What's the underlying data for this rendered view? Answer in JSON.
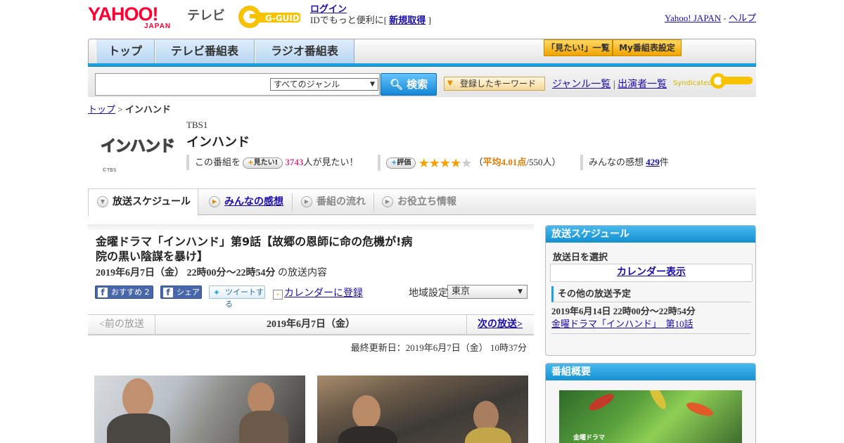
{
  "header": {
    "yahoo_logo": "YAHOO!",
    "yahoo_logo_sub": "JAPAN",
    "tv_label": "テレビ",
    "gguide_logo": "G-GUIDE",
    "login": "ログイン",
    "id_note_prefix": "IDでもっと便利に[",
    "signup": "新規取得",
    "id_note_suffix": "]",
    "yahoo_japan_link": "Yahoo! JAPAN",
    "separator": "-",
    "help_link": "ヘルプ"
  },
  "nav": {
    "top": "トップ",
    "tv_schedule": "テレビ番組表",
    "radio_schedule": "ラジオ番組表",
    "watchlist": "「見たい!」一覧",
    "my_schedule": "My番組表設定"
  },
  "search": {
    "placeholder": "",
    "genre_selected": "すべてのジャンル",
    "button": "検索",
    "keyword_button": "登録したキーワード",
    "genre_list": "ジャンル一覧",
    "pipe": "|",
    "performer_list": "出演者一覧",
    "syndicated": "Syndicated"
  },
  "breadcrumb": {
    "top": "トップ",
    "sep": ">",
    "current": "インハンド"
  },
  "program": {
    "logo_text": "インハンド",
    "logo_copyright": "©TBS",
    "station": "TBS1",
    "title": "インハンド",
    "want_prefix": "この番組を",
    "want_button": "見たい!",
    "want_count": "3743",
    "want_suffix": "人が見たい！",
    "rating_button": "評価",
    "rating_value": 4.01,
    "avg_label_open": "（",
    "avg_label": "平均4.01点",
    "avg_count": "/550人）",
    "reviews_label": "みんなの感想",
    "reviews_count": "429",
    "reviews_suffix": "件"
  },
  "section_tabs": {
    "schedule": "放送スケジュール",
    "reviews": "みんなの感想",
    "flow": "番組の流れ",
    "info": "お役立ち情報"
  },
  "episode": {
    "title": "金曜ドラマ「インハンド」第9話【故郷の恩師に命の危機が!病院の黒い陰謀を暴け】",
    "datetime": "2019年6月7日（金）  22時00分～22時54分",
    "datetime_suffix": "の放送内容",
    "fb_recommend": "おすすめ 2",
    "fb_share": "シェア",
    "tweet": "ツイートする",
    "calendar": "カレンダーに登録",
    "region_label": "地域設定",
    "region_value": "東京",
    "prev": "<前の放送",
    "current_date": "2019年6月7日（金）",
    "next": "次の放送>",
    "updated": "最終更新日：2019年6月7日（金）  10時37分"
  },
  "sidebar": {
    "schedule_header": "放送スケジュール",
    "select_date": "放送日を選択",
    "calendar_show": "カレンダー表示",
    "other_label": "その他の放送予定",
    "other_date": "2019年6月14日  22時00分～22時54分",
    "other_link": "金曜ドラマ「インハンド」　第10話",
    "overview_header": "番組概要",
    "overview_img_text": "金曜ドラマ"
  },
  "colors": {
    "accent_blue": "#1aa0e0",
    "link": "#1a0dab",
    "yahoo_red": "#ff0033",
    "star": "#f4a000",
    "want_pink": "#e03a8c"
  }
}
